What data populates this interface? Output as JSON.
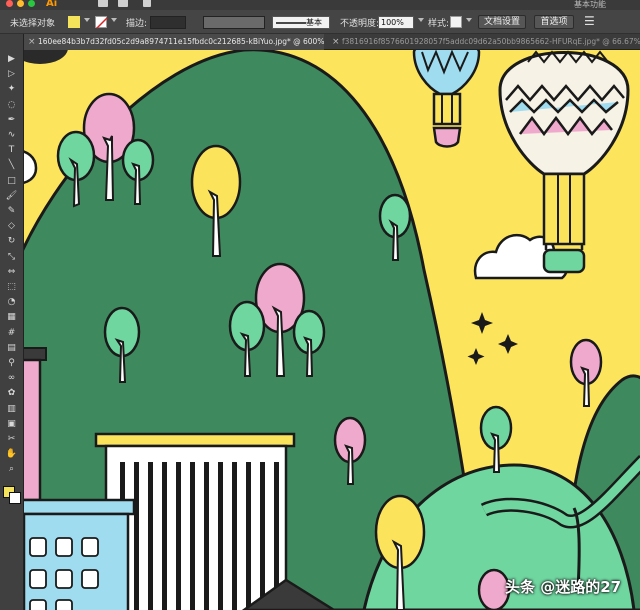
{
  "app": {
    "logo_text": "Ai",
    "workspace": "基本功能"
  },
  "controlbar": {
    "selection_status": "未选择对象",
    "stroke_label": "描边:",
    "stroke_style": "基本",
    "opacity_label": "不透明度:",
    "opacity_value": "100%",
    "style_label": "样式:",
    "doc_setup_button": "文档设置",
    "preferences_button": "首选项",
    "fill_color": "#f6e35c"
  },
  "tabs": [
    {
      "label": "160ee84b3b7d32fd05c2d9a8974711e15fbdc0c212685-kBiYuo.jpg* @ 600% (RGB/GPU 预览)",
      "state": "active"
    },
    {
      "label": "f3816916f8576601928057f5addc09d62a50bb9865662-HFURqE.jpg* @ 66.67% (",
      "state": "inactive"
    }
  ],
  "tools": [
    "selection-tool",
    "direct-selection-tool",
    "magic-wand-tool",
    "lasso-tool",
    "pen-tool",
    "curvature-tool",
    "type-tool",
    "line-tool",
    "rectangle-tool",
    "paintbrush-tool",
    "pencil-tool",
    "eraser-tool",
    "rotate-tool",
    "scale-tool",
    "width-tool",
    "free-transform-tool",
    "shape-builder-tool",
    "perspective-grid-tool",
    "mesh-tool",
    "gradient-tool",
    "eyedropper-tool",
    "blend-tool",
    "symbol-sprayer-tool",
    "column-graph-tool",
    "artboard-tool",
    "slice-tool",
    "hand-tool",
    "zoom-tool"
  ],
  "palette": {
    "sky": "#fce45c",
    "hill": "#3e8a5e",
    "mint": "#6fd6a0",
    "pink": "#efa9cc",
    "yellow": "#fbe45c",
    "cyan": "#9fdcef",
    "outline": "#1a1a1a"
  },
  "watermark": "头条 @迷路的27"
}
